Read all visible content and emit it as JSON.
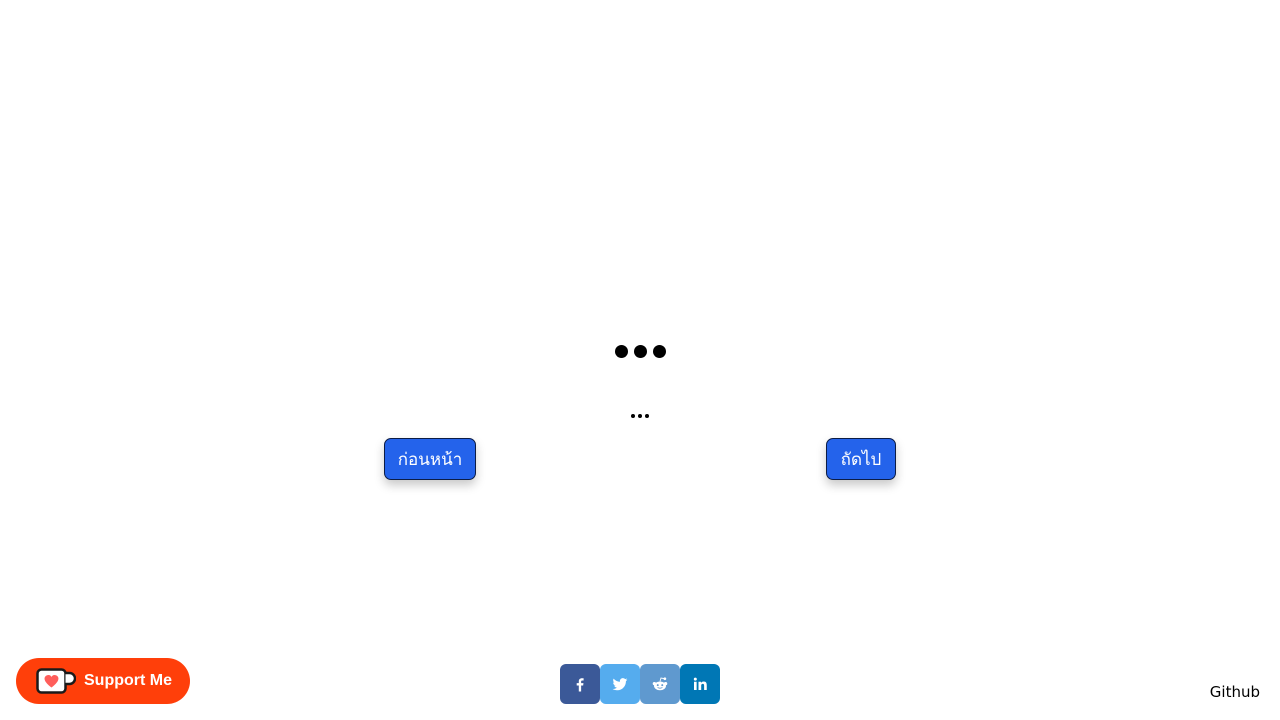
{
  "loader": {
    "large_dots": "●●●",
    "small_dots": "..."
  },
  "navigation": {
    "previous_label": "ก่อนหน้า",
    "next_label": "ถัดไป",
    "button_color": "#2463eb"
  },
  "support": {
    "label": "Support Me",
    "icon": "kofi-cup-icon",
    "color": "#ff3f0a"
  },
  "share": {
    "buttons": [
      {
        "network": "facebook",
        "icon": "facebook-icon",
        "color": "#3b5998"
      },
      {
        "network": "twitter",
        "icon": "twitter-icon",
        "color": "#55acee"
      },
      {
        "network": "reddit",
        "icon": "reddit-icon",
        "color": "#5f99cf"
      },
      {
        "network": "linkedin",
        "icon": "linkedin-icon",
        "color": "#0077b5"
      }
    ]
  },
  "footer": {
    "github_label": "Github"
  }
}
